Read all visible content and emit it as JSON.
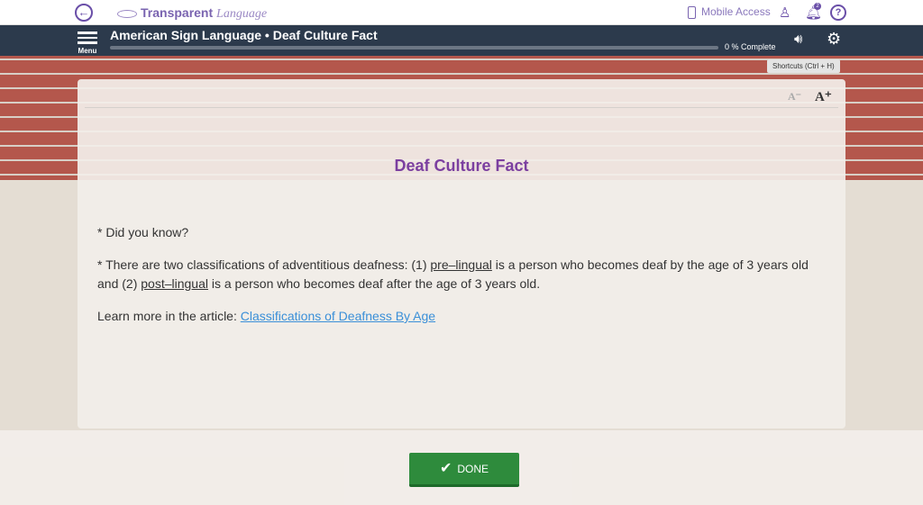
{
  "header": {
    "logo_bold": "Transparent",
    "logo_italic": "Language",
    "mobile_access": "Mobile Access",
    "notification_count": "2",
    "help": "?"
  },
  "navbar": {
    "menu_label": "Menu",
    "title": "American Sign Language • Deaf Culture Fact",
    "progress_percent": 0,
    "progress_text": "0 % Complete"
  },
  "tooltip": "Shortcuts (Ctrl + H)",
  "content": {
    "font_decrease": "A⁻",
    "font_increase": "A⁺",
    "heading": "Deaf Culture Fact",
    "p1": "* Did you know?",
    "p2_a": "* There are two classifications of adventitious deafness: (1) ",
    "p2_term1": "pre–lingual",
    "p2_b": " is a person who becomes deaf by the age of 3 years old and (2) ",
    "p2_term2": "post–lingual",
    "p2_c": " is a person who becomes deaf after the age of 3 years old.",
    "p3_a": "Learn more in the article: ",
    "p3_link": "Classifications of Deafness By Age"
  },
  "done_label": "DONE",
  "colors": {
    "accent": "#7b3fa0",
    "navbar": "#2c3a4c",
    "done": "#2e8b3c",
    "link": "#3a8fd8"
  }
}
